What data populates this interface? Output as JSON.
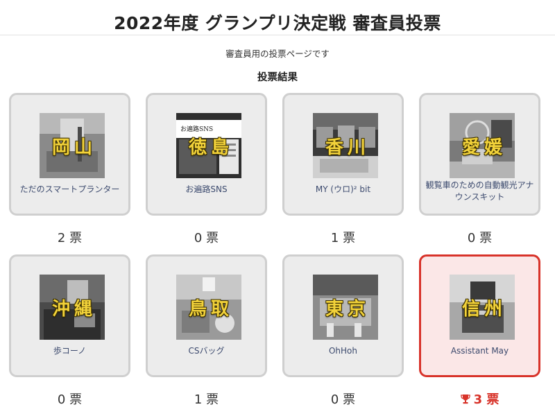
{
  "page": {
    "title": "2022年度 グランプリ決定戦 審査員投票",
    "subtitle": "審査員用の投票ページです",
    "results_heading": "投票結果",
    "vote_unit": "票"
  },
  "entries": [
    {
      "prefecture": "岡山",
      "name": "ただのスマートプランター",
      "votes": "2",
      "winner": false
    },
    {
      "prefecture": "徳島",
      "name": "お遍路SNS",
      "votes": "0",
      "winner": false,
      "thumb_caption": "お遍路SNS"
    },
    {
      "prefecture": "香川",
      "name": "MY (ウロ)² bit",
      "votes": "1",
      "winner": false
    },
    {
      "prefecture": "愛媛",
      "name": "観覧車のための自動観光アナウンスキット",
      "votes": "0",
      "winner": false
    },
    {
      "prefecture": "沖縄",
      "name": "歩コーノ",
      "votes": "0",
      "winner": false
    },
    {
      "prefecture": "鳥取",
      "name": "CSバッグ",
      "votes": "1",
      "winner": false
    },
    {
      "prefecture": "東京",
      "name": "OhHoh",
      "votes": "0",
      "winner": false
    },
    {
      "prefecture": "信州",
      "name": "Assistant May",
      "votes": "3",
      "winner": true
    }
  ],
  "colors": {
    "winner_accent": "#d8332a",
    "winner_card_bg": "#fbe7e7",
    "card_border": "#cfcfcf",
    "card_bg": "#ececec",
    "label_text": "#3c4a6e",
    "prefecture_text": "#f2d23a"
  },
  "icons": {
    "winner_icon": "trophy-icon"
  }
}
